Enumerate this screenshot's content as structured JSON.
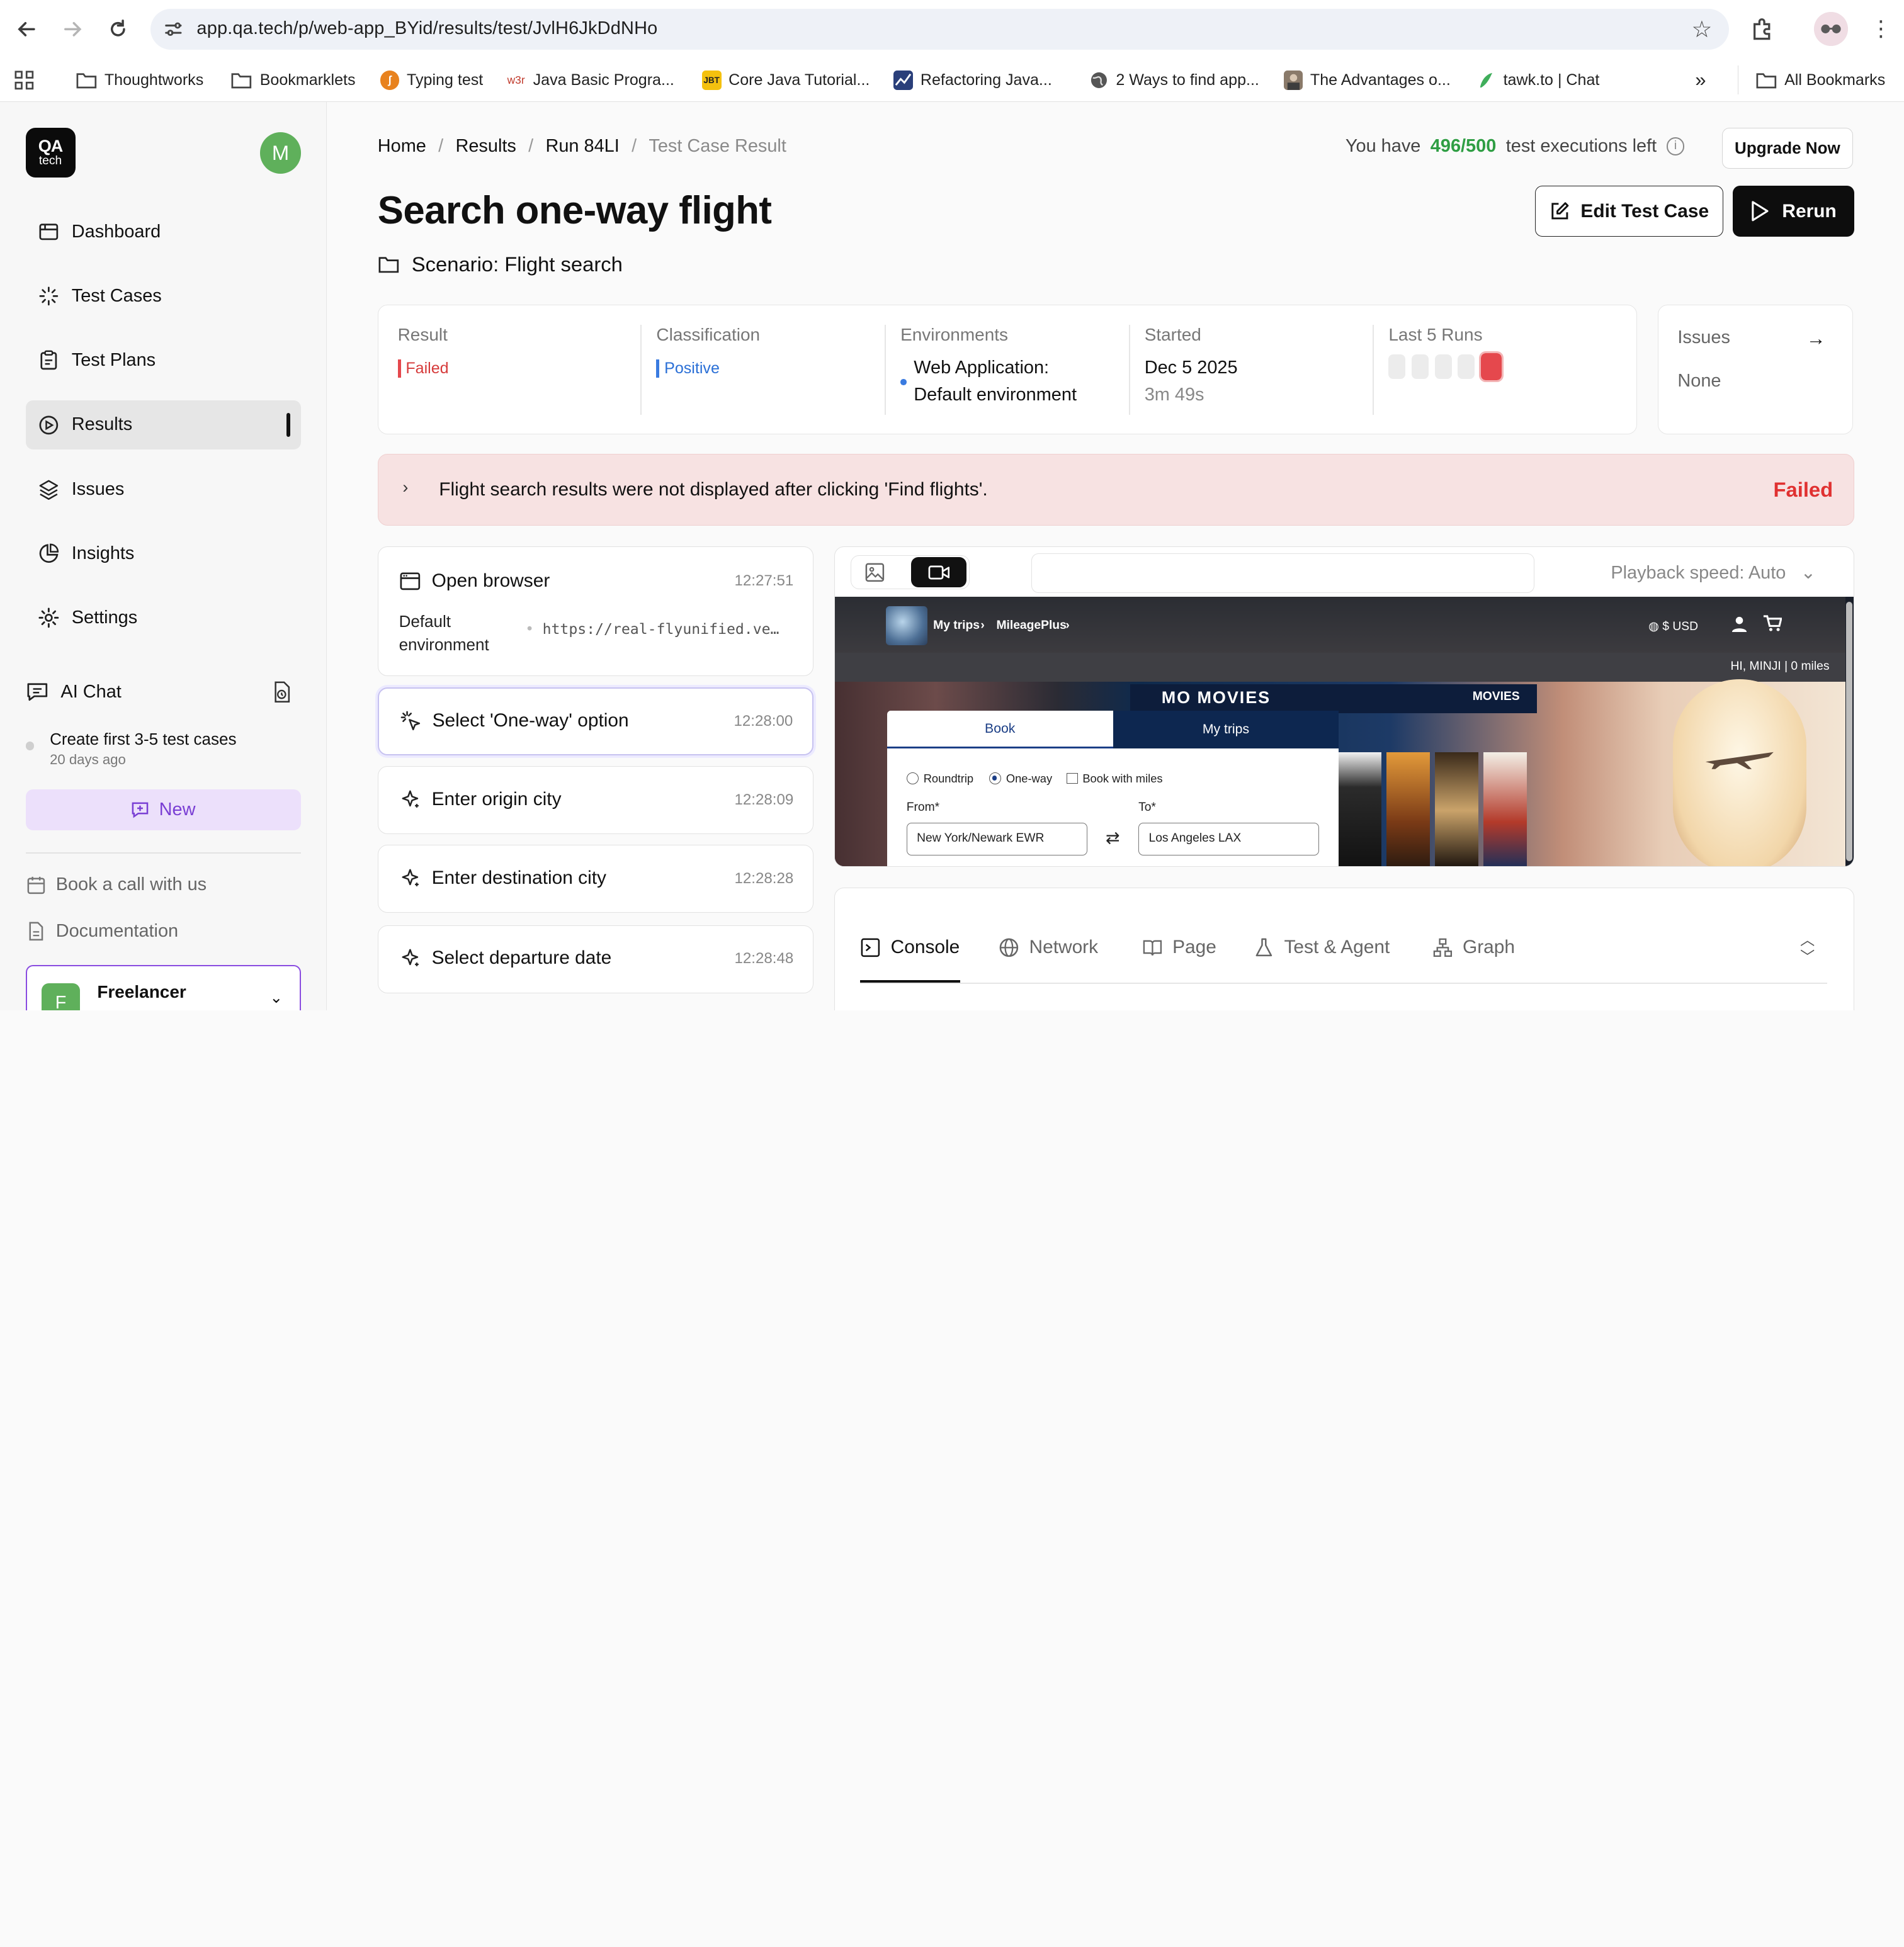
{
  "browser": {
    "url": "app.qa.tech/p/web-app_BYid/results/test/JvlH6JkDdNHo",
    "bookmarks": [
      {
        "label": "Thoughtworks",
        "icon": "folder-icon"
      },
      {
        "label": "Bookmarklets",
        "icon": "folder-icon"
      },
      {
        "label": "Typing test",
        "icon": "typing-test-icon"
      },
      {
        "label": "Java Basic Progra...",
        "icon": "w3r-icon",
        "icon_text": "w3r"
      },
      {
        "label": "Core Java Tutorial...",
        "icon": "jbt-icon",
        "icon_text": "JBT"
      },
      {
        "label": "Refactoring Java...",
        "icon": "refactoring-icon"
      },
      {
        "label": "2 Ways to find app...",
        "icon": "globe-icon"
      },
      {
        "label": "The Advantages o...",
        "icon": "portrait-icon"
      },
      {
        "label": "tawk.to | Chat",
        "icon": "tawk-icon"
      }
    ],
    "more": "»",
    "all_bookmarks": "All Bookmarks"
  },
  "sidebar": {
    "logo_line1": "QA",
    "logo_line2": "tech",
    "avatar": "M",
    "items": [
      {
        "label": "Dashboard",
        "icon": "dashboard-icon"
      },
      {
        "label": "Test Cases",
        "icon": "test-cases-icon"
      },
      {
        "label": "Test Plans",
        "icon": "test-plans-icon"
      },
      {
        "label": "Results",
        "icon": "results-icon",
        "active": true
      },
      {
        "label": "Issues",
        "icon": "issues-icon"
      },
      {
        "label": "Insights",
        "icon": "insights-icon"
      },
      {
        "label": "Settings",
        "icon": "settings-icon"
      }
    ],
    "ai_chat": "AI Chat",
    "chat_entry": {
      "title": "Create first 3-5 test cases",
      "when": "20 days ago"
    },
    "new_label": "New",
    "book_call": "Book a call with us",
    "documentation": "Documentation",
    "org": {
      "badge": "F",
      "name": "Freelancer"
    }
  },
  "header": {
    "breadcrumbs": [
      "Home",
      "Results",
      "Run 84LI",
      "Test Case Result"
    ],
    "quota_prefix": "You have",
    "quota_value": "496/500",
    "quota_suffix": "test executions left",
    "upgrade": "Upgrade Now",
    "title": "Search one-way flight",
    "scenario": "Scenario: Flight search",
    "edit_button": "Edit Test Case",
    "rerun_button": "Rerun"
  },
  "summary": {
    "result_label": "Result",
    "result_value": "Failed",
    "classification_label": "Classification",
    "classification_value": "Positive",
    "environments_label": "Environments",
    "environments_line1": "Web Application:",
    "environments_line2": "Default environment",
    "started_label": "Started",
    "started_date": "Dec 5 2025",
    "started_duration": "3m 49s",
    "last_runs_label": "Last 5 Runs",
    "last_runs": [
      "none",
      "none",
      "none",
      "none",
      "failed"
    ],
    "issues_label": "Issues",
    "issues_value": "None"
  },
  "banner": {
    "message": "Flight search results were not displayed after clicking 'Find flights'.",
    "status": "Failed"
  },
  "steps": [
    {
      "name": "Open browser",
      "time": "12:27:51",
      "detail_label": "Default environment",
      "detail_value": "https://real-flyunified.ve…"
    },
    {
      "name": "Select 'One-way' option",
      "time": "12:28:00"
    },
    {
      "name": "Enter origin city",
      "time": "12:28:09"
    },
    {
      "name": "Enter destination city",
      "time": "12:28:28"
    },
    {
      "name": "Select departure date",
      "time": "12:28:48"
    }
  ],
  "player": {
    "playback_speed": "Playback speed: Auto",
    "video": {
      "nav_trips": "My trips",
      "nav_mileage": "MileagePlus",
      "currency": "$ USD",
      "greeting": "HI, MINJI | 0 miles",
      "movies_title": "MO    MOVIES",
      "movies_link": "MOVIES",
      "tab_book": "Book",
      "tab_trips": "My trips",
      "radio_roundtrip": "Roundtrip",
      "radio_oneway": "One-way",
      "check_miles": "Book with miles",
      "from_label": "From*",
      "to_label": "To*",
      "from_value": "New York/Newark EWR",
      "to_value": "Los Angeles LAX"
    }
  },
  "tabs": [
    "Console",
    "Network",
    "Page",
    "Test & Agent",
    "Graph"
  ],
  "colors": {
    "accent_green": "#2f9e44",
    "fail_red": "#e03131",
    "positive_blue": "#2a6fd6",
    "new_purple": "#7a3fd4"
  }
}
